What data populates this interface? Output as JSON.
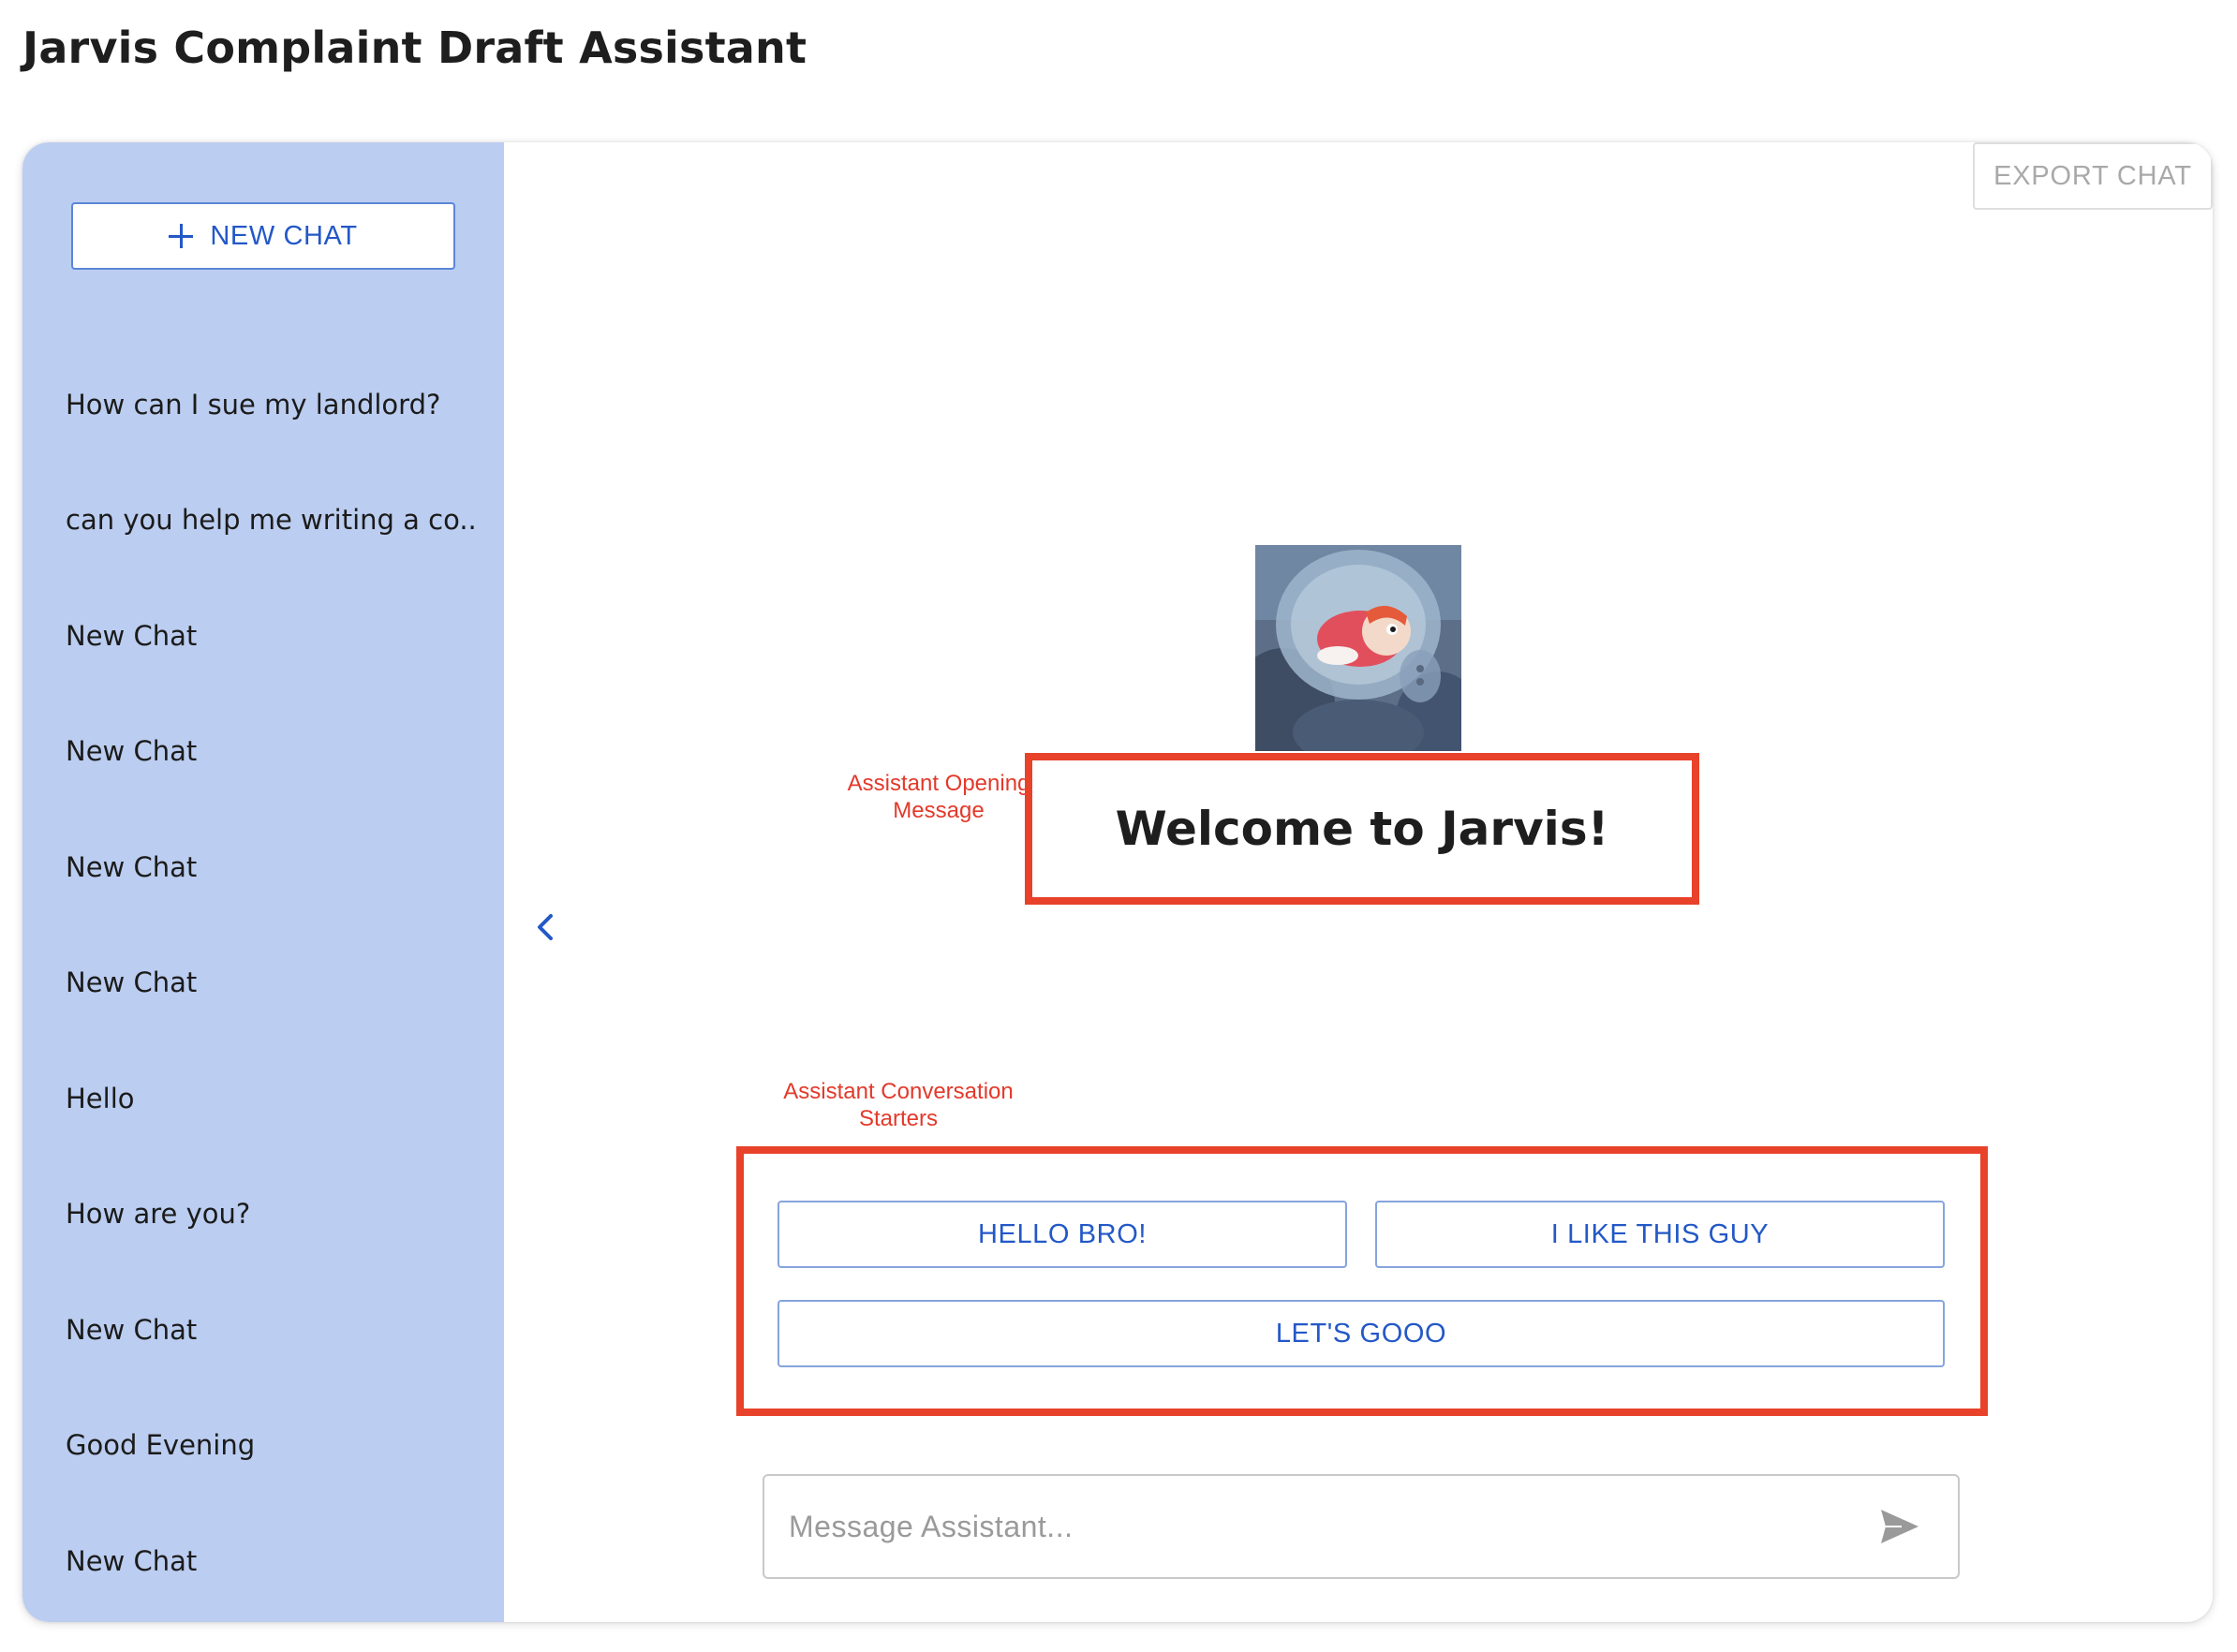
{
  "page": {
    "title": "Jarvis Complaint Draft Assistant"
  },
  "sidebar": {
    "new_chat_label": "NEW CHAT",
    "items": [
      {
        "label": "How can I sue my landlord?"
      },
      {
        "label": "can you help me writing a co..."
      },
      {
        "label": "New Chat"
      },
      {
        "label": "New Chat"
      },
      {
        "label": "New Chat"
      },
      {
        "label": "New Chat"
      },
      {
        "label": "Hello"
      },
      {
        "label": "How are you?"
      },
      {
        "label": "New Chat"
      },
      {
        "label": "Good Evening"
      },
      {
        "label": "New Chat"
      }
    ]
  },
  "toolbar": {
    "export_label": "EXPORT CHAT"
  },
  "main": {
    "welcome": "Welcome to Jarvis!",
    "annotations": {
      "opening_line1": "Assistant Opening",
      "opening_line2": "Message",
      "starters_line1": "Assistant Conversation",
      "starters_line2": "Starters"
    },
    "starters": [
      {
        "label": "HELLO BRO!"
      },
      {
        "label": "I LIKE THIS GUY"
      },
      {
        "label": "LET'S GOOO"
      }
    ],
    "message_placeholder": "Message Assistant..."
  },
  "icons": {
    "new_chat": "plus-icon",
    "collapse": "chevron-left-icon",
    "send": "send-icon",
    "avatar": "assistant-avatar"
  },
  "colors": {
    "accent": "#2358c7",
    "sidebar_bg": "#bbcdf0",
    "annotation": "#e3392a"
  }
}
